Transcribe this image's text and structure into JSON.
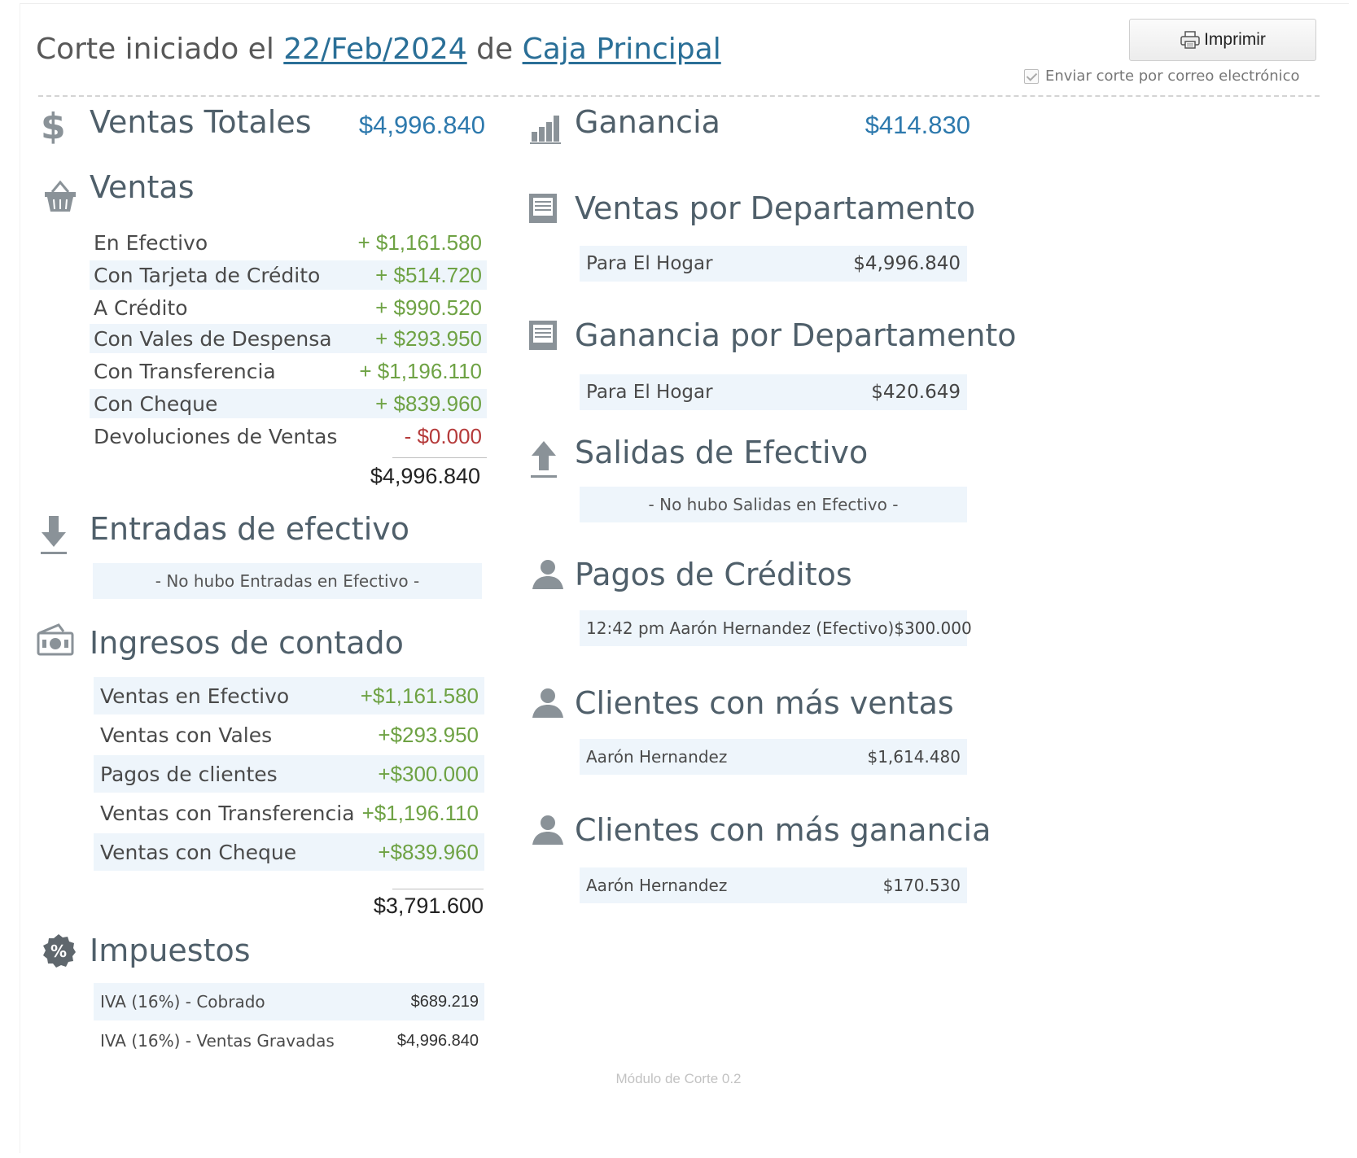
{
  "header": {
    "prefix": "Corte iniciado el",
    "date": "22/Feb/2024",
    "connector": "de",
    "register": "Caja Principal",
    "print_label": "Imprimir",
    "email_label": "Enviar corte por correo electrónico"
  },
  "ventas_totales": {
    "title": "Ventas Totales",
    "value": "$4,996.840"
  },
  "ganancia": {
    "title": "Ganancia",
    "value": "$414.830"
  },
  "ventas": {
    "title": "Ventas",
    "rows": [
      {
        "label": "En Efectivo",
        "value": "+ $1,161.580"
      },
      {
        "label": "Con Tarjeta de Crédito",
        "value": "+ $514.720"
      },
      {
        "label": "A Crédito",
        "value": "+ $990.520"
      },
      {
        "label": "Con Vales de Despensa",
        "value": "+ $293.950"
      },
      {
        "label": "Con Transferencia",
        "value": "+ $1,196.110"
      },
      {
        "label": "Con Cheque",
        "value": "+ $839.960"
      },
      {
        "label": "Devoluciones de Ventas",
        "value": "- $0.000"
      }
    ],
    "total": "$4,996.840"
  },
  "entradas": {
    "title": "Entradas de efectivo",
    "empty": "- No hubo Entradas en Efectivo -"
  },
  "ingresos": {
    "title": "Ingresos de contado",
    "rows": [
      {
        "label": "Ventas en Efectivo",
        "value": "+$1,161.580"
      },
      {
        "label": "Ventas con Vales",
        "value": "+$293.950"
      },
      {
        "label": "Pagos de clientes",
        "value": "+$300.000"
      },
      {
        "label": "Ventas con Transferencia",
        "value": "+$1,196.110"
      },
      {
        "label": "Ventas con Cheque",
        "value": "+$839.960"
      }
    ],
    "total": "$3,791.600"
  },
  "impuestos": {
    "title": "Impuestos",
    "rows": [
      {
        "label": "IVA (16%) - Cobrado",
        "value": "$689.219"
      },
      {
        "label": "IVA (16%) - Ventas Gravadas",
        "value": "$4,996.840"
      }
    ]
  },
  "ventas_depto": {
    "title": "Ventas por Departamento",
    "rows": [
      {
        "label": "Para El Hogar",
        "value": "$4,996.840"
      }
    ]
  },
  "ganancia_depto": {
    "title": "Ganancia por Departamento",
    "rows": [
      {
        "label": "Para El Hogar",
        "value": "$420.649"
      }
    ]
  },
  "salidas": {
    "title": "Salidas de Efectivo",
    "empty": "- No hubo Salidas en Efectivo -"
  },
  "pagos_creditos": {
    "title": "Pagos de Créditos",
    "rows": [
      {
        "label": "12:42 pm Aarón Hernandez (Efectivo)",
        "value": "$300.000"
      }
    ]
  },
  "clientes_ventas": {
    "title": "Clientes con más ventas",
    "rows": [
      {
        "label": "Aarón Hernandez",
        "value": "$1,614.480"
      }
    ]
  },
  "clientes_ganancia": {
    "title": "Clientes con más ganancia",
    "rows": [
      {
        "label": "Aarón Hernandez",
        "value": "$170.530"
      }
    ]
  },
  "footer": "Módulo de Corte 0.2",
  "colors": {
    "accent_blue": "#2d79ad",
    "positive_green": "#6ea244",
    "negative_red": "#b53a3a",
    "row_shade": "#eef5fb"
  },
  "icons": [
    "dollar-icon",
    "bar-chart-icon",
    "basket-icon",
    "document-icon",
    "arrow-down-icon",
    "arrow-up-icon",
    "cash-icon",
    "user-icon",
    "percent-icon",
    "printer-icon"
  ]
}
